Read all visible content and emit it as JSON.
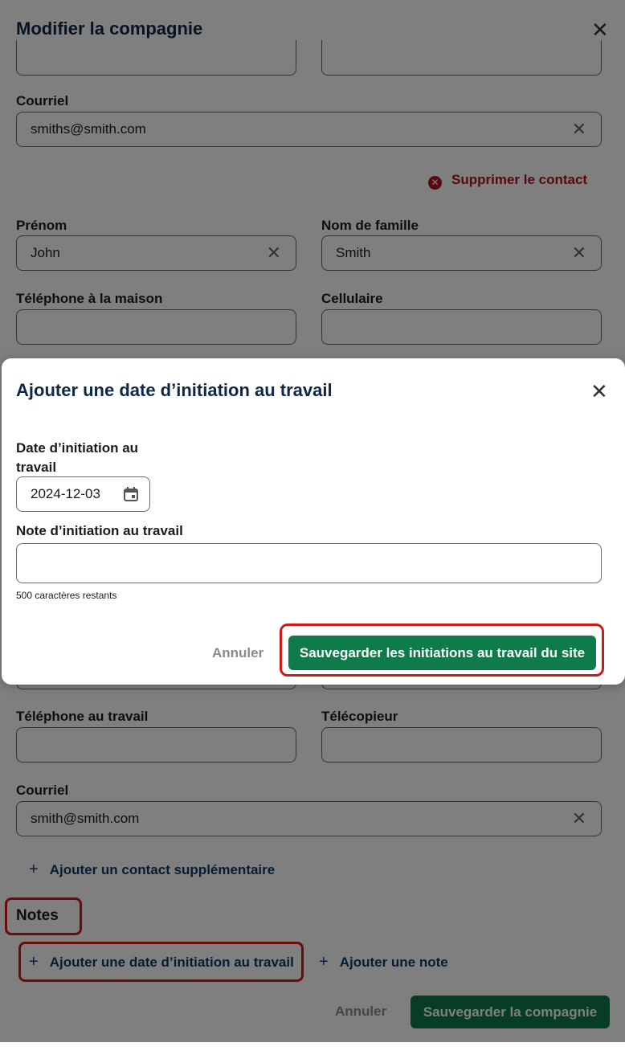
{
  "company_dialog": {
    "title": "Modifier la compagnie",
    "close_icon": "close-icon",
    "contact1": {
      "email_label": "Courriel",
      "email_value": "smiths@smith.com"
    },
    "delete_contact_label": "Supprimer le contact",
    "contact2": {
      "first_name_label": "Prénom",
      "first_name_value": "John",
      "last_name_label": "Nom de famille",
      "last_name_value": "Smith",
      "home_phone_label": "Téléphone à la maison",
      "home_phone_value": "",
      "cell_label": "Cellulaire",
      "cell_value": "",
      "work_phone_label": "Téléphone au travail",
      "work_phone_value": "",
      "fax_label": "Télécopieur",
      "fax_value": "",
      "email_label": "Courriel",
      "email_value": "smith@smith.com"
    },
    "add_contact_label": "Ajouter un contact supplémentaire",
    "notes_heading": "Notes",
    "add_initiation_label": "Ajouter une date d’initiation au travail",
    "add_note_label": "Ajouter une note",
    "cancel_label": "Annuler",
    "save_label": "Sauvegarder la compagnie"
  },
  "initiation_modal": {
    "title": "Ajouter une date d’initiation au travail",
    "date_label_line1": "Date d’initiation au",
    "date_label_line2": "travail",
    "date_value": "2024-12-03",
    "note_label": "Note d’initiation au travail",
    "note_value": "",
    "chars_remaining": "500 caractères restants",
    "cancel_label": "Annuler",
    "save_label": "Sauvegarder les initiations au travail du site"
  },
  "colors": {
    "primary_green": "#0f7a4a",
    "link_blue": "#0d3b66",
    "danger_red": "#b3121b",
    "highlight_red": "#d01919"
  }
}
